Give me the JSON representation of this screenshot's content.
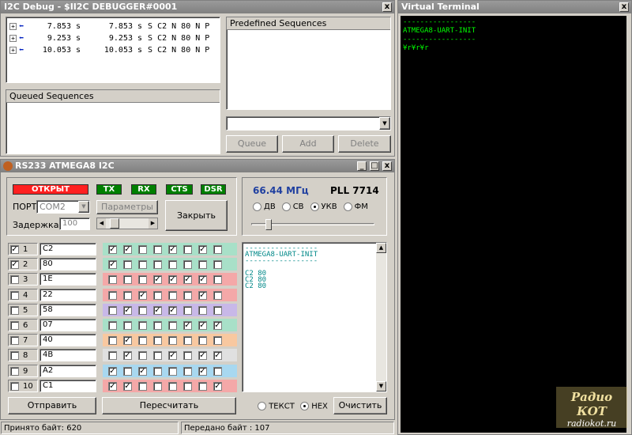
{
  "i2c": {
    "title": "I2C Debug - $II2C DEBUGGER#0001",
    "close": "x",
    "log": [
      {
        "expand": "+",
        "t1": "7.853 s",
        "t2": "7.853 s",
        "text": "S C2 N 80 N P"
      },
      {
        "expand": "+",
        "t1": "9.253 s",
        "t2": "9.253 s",
        "text": "S C2 N 80 N P"
      },
      {
        "expand": "+",
        "t1": "10.053 s",
        "t2": "10.053 s",
        "text": "S C2 N 80 N P"
      }
    ],
    "predefined_label": "Predefined Sequences",
    "queued_label": "Queued Sequences",
    "combo_arrow": "▼",
    "btn_queue": "Queue",
    "btn_add": "Add",
    "btn_delete": "Delete"
  },
  "vt": {
    "title": "Virtual Terminal",
    "close": "x",
    "lines": [
      "-----------------",
      "ATMEGA8-UART-INIT",
      "-----------------",
      "¥r¥r¥r"
    ]
  },
  "rs": {
    "title": "RS233 ATMEGA8 I2C",
    "open_btn": "ОТКРЫТ",
    "leds": [
      "TX",
      "RX",
      "CTS",
      "DSR"
    ],
    "port_label": "ПОРТ",
    "port_value": "COM2",
    "params_btn": "Параметры",
    "close_btn": "Закрыть",
    "delay_label": "Задержка",
    "delay_value": "100",
    "slider_value": 0.12,
    "freq": "66.44",
    "freq_unit": "МГц",
    "pll": "PLL 7714",
    "bands": [
      {
        "label": "ДВ",
        "checked": false
      },
      {
        "label": "СВ",
        "checked": false
      },
      {
        "label": "УКВ",
        "checked": true
      },
      {
        "label": "ФМ",
        "checked": false
      }
    ],
    "tuner_value": 0.12,
    "rows": [
      {
        "num": "1",
        "checked": true,
        "value": "C2",
        "bits": [
          1,
          1,
          0,
          0,
          1,
          0,
          1,
          0
        ],
        "color": "#a8e0c8"
      },
      {
        "num": "2",
        "checked": true,
        "value": "80",
        "bits": [
          1,
          0,
          0,
          0,
          0,
          0,
          0,
          0
        ],
        "color": "#a8e0c8"
      },
      {
        "num": "3",
        "checked": false,
        "value": "1E",
        "bits": [
          0,
          0,
          0,
          1,
          1,
          1,
          1,
          0
        ],
        "color": "#f4a8a8"
      },
      {
        "num": "4",
        "checked": false,
        "value": "22",
        "bits": [
          0,
          0,
          1,
          0,
          0,
          0,
          1,
          0
        ],
        "color": "#f4a8a8"
      },
      {
        "num": "5",
        "checked": false,
        "value": "58",
        "bits": [
          0,
          1,
          0,
          1,
          1,
          0,
          0,
          0
        ],
        "color": "#c8b8e8"
      },
      {
        "num": "6",
        "checked": false,
        "value": "07",
        "bits": [
          0,
          0,
          0,
          0,
          0,
          1,
          1,
          1
        ],
        "color": "#a8e0c8"
      },
      {
        "num": "7",
        "checked": false,
        "value": "40",
        "bits": [
          0,
          1,
          0,
          0,
          0,
          0,
          0,
          0
        ],
        "color": "#f8c8a0"
      },
      {
        "num": "8",
        "checked": false,
        "value": "4B",
        "bits": [
          0,
          1,
          0,
          0,
          1,
          0,
          1,
          1
        ],
        "color": "#e0e0e0"
      },
      {
        "num": "9",
        "checked": false,
        "value": "A2",
        "bits": [
          1,
          0,
          1,
          0,
          0,
          0,
          1,
          0
        ],
        "color": "#a8d8f0"
      },
      {
        "num": "10",
        "checked": false,
        "value": "C1",
        "bits": [
          1,
          1,
          0,
          0,
          0,
          0,
          0,
          1
        ],
        "color": "#f4a8a8"
      }
    ],
    "terminal": [
      "-----------------",
      "ATMEGA8-UART-INIT",
      "-----------------",
      "",
      "C2 80",
      "C2 80",
      "C2 80"
    ],
    "send_btn": "Отправить",
    "recalc_btn": "Пересчитать",
    "mode_text": "ТЕКСТ",
    "mode_hex": "HEX",
    "mode_selected": "HEX",
    "clear_btn": "Очистить"
  },
  "status": {
    "received": "Принято байт: 620",
    "sent": "Передано байт : 107"
  },
  "watermark": {
    "line1": "Радио КОТ",
    "line2": "radiokot.ru"
  },
  "colors": {
    "accent_red": "#ff2020",
    "led_green": "#008000",
    "freq_blue": "#2040a0",
    "terminal_green": "#00ff00",
    "terminal_teal": "#008888"
  }
}
